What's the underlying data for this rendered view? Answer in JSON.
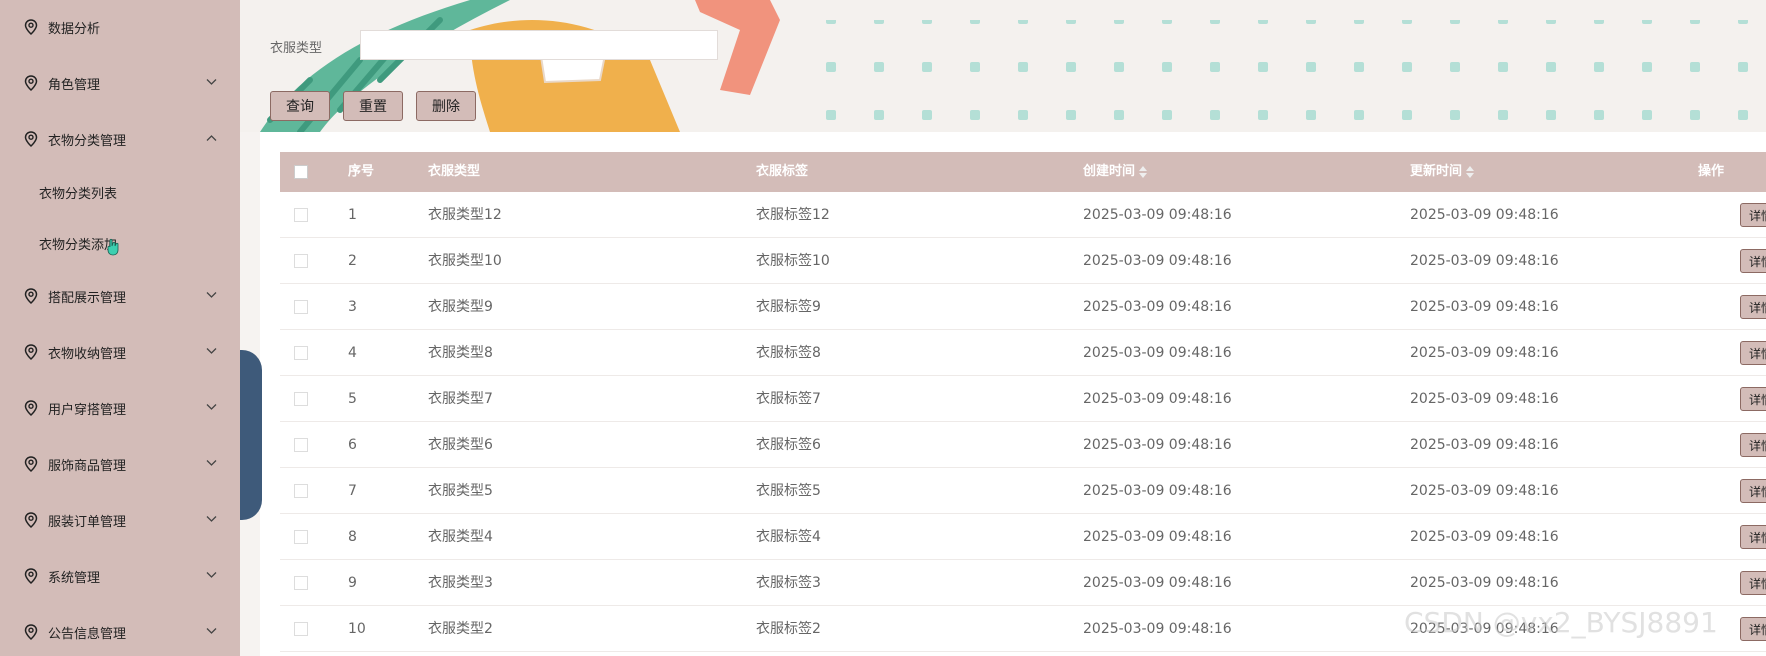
{
  "sidebar": {
    "items": [
      {
        "label": "数据分析",
        "expandable": false
      },
      {
        "label": "角色管理",
        "expandable": true
      },
      {
        "label": "衣物分类管理",
        "expandable": true,
        "expanded": true
      },
      {
        "label": "搭配展示管理",
        "expandable": true
      },
      {
        "label": "衣物收纳管理",
        "expandable": true
      },
      {
        "label": "用户穿搭管理",
        "expandable": true
      },
      {
        "label": "服饰商品管理",
        "expandable": true
      },
      {
        "label": "服装订单管理",
        "expandable": true
      },
      {
        "label": "系统管理",
        "expandable": true
      },
      {
        "label": "公告信息管理",
        "expandable": true
      }
    ],
    "sub_items": [
      {
        "label": "衣物分类列表"
      },
      {
        "label": "衣物分类添加"
      }
    ]
  },
  "search": {
    "label": "衣服类型",
    "value": "",
    "placeholder": ""
  },
  "buttons": {
    "query": "查询",
    "reset": "重置",
    "delete": "删除"
  },
  "table": {
    "headers": {
      "index": "序号",
      "type": "衣服类型",
      "tag": "衣服标签",
      "created": "创建时间",
      "updated": "更新时间",
      "action": "操作"
    },
    "detail_label": "详情",
    "rows": [
      {
        "index": "1",
        "type": "衣服类型12",
        "tag": "衣服标签12",
        "created": "2025-03-09 09:48:16",
        "updated": "2025-03-09 09:48:16"
      },
      {
        "index": "2",
        "type": "衣服类型10",
        "tag": "衣服标签10",
        "created": "2025-03-09 09:48:16",
        "updated": "2025-03-09 09:48:16"
      },
      {
        "index": "3",
        "type": "衣服类型9",
        "tag": "衣服标签9",
        "created": "2025-03-09 09:48:16",
        "updated": "2025-03-09 09:48:16"
      },
      {
        "index": "4",
        "type": "衣服类型8",
        "tag": "衣服标签8",
        "created": "2025-03-09 09:48:16",
        "updated": "2025-03-09 09:48:16"
      },
      {
        "index": "5",
        "type": "衣服类型7",
        "tag": "衣服标签7",
        "created": "2025-03-09 09:48:16",
        "updated": "2025-03-09 09:48:16"
      },
      {
        "index": "6",
        "type": "衣服类型6",
        "tag": "衣服标签6",
        "created": "2025-03-09 09:48:16",
        "updated": "2025-03-09 09:48:16"
      },
      {
        "index": "7",
        "type": "衣服类型5",
        "tag": "衣服标签5",
        "created": "2025-03-09 09:48:16",
        "updated": "2025-03-09 09:48:16"
      },
      {
        "index": "8",
        "type": "衣服类型4",
        "tag": "衣服标签4",
        "created": "2025-03-09 09:48:16",
        "updated": "2025-03-09 09:48:16"
      },
      {
        "index": "9",
        "type": "衣服类型3",
        "tag": "衣服标签3",
        "created": "2025-03-09 09:48:16",
        "updated": "2025-03-09 09:48:16"
      },
      {
        "index": "10",
        "type": "衣服类型2",
        "tag": "衣服标签2",
        "created": "2025-03-09 09:48:16",
        "updated": "2025-03-09 09:48:16"
      }
    ]
  },
  "watermark": "CSDN @vx2_BYSJ8891",
  "icons": {
    "menu": "location-pin-icon",
    "expand": "chevron-down-icon",
    "collapse": "chevron-up-icon",
    "sort": "sort-icon"
  },
  "colors": {
    "sidebar_bg": "#d3bcb8",
    "header_bg": "#d3bcb8",
    "button_border": "#8c6a63"
  }
}
